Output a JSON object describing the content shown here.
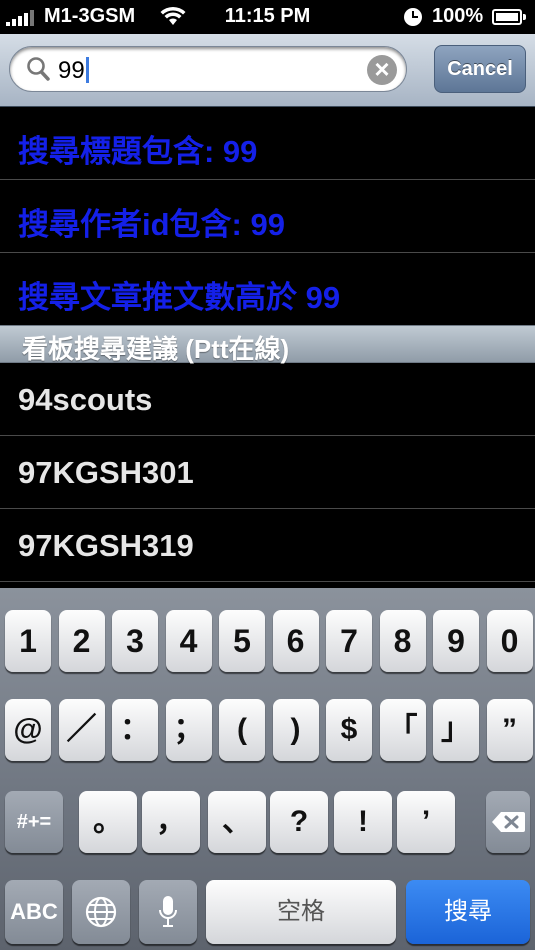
{
  "status_bar": {
    "carrier": "M1-3GSM",
    "time": "11:15 PM",
    "battery": "100%"
  },
  "search": {
    "value": "99",
    "cancel_label": "Cancel"
  },
  "suggestions": [
    {
      "label": "搜尋標題包含: 99"
    },
    {
      "label": "搜尋作者id包含: 99"
    },
    {
      "label": "搜尋文章推文數高於 99"
    }
  ],
  "board_section": {
    "header": "看板搜尋建議 (Ptt在線)",
    "items": [
      {
        "label": "94scouts"
      },
      {
        "label": "97KGSH301"
      },
      {
        "label": "97KGSH319"
      }
    ]
  },
  "keyboard": {
    "row1": [
      "1",
      "2",
      "3",
      "4",
      "5",
      "6",
      "7",
      "8",
      "9",
      "0"
    ],
    "row2": [
      "@",
      "／",
      "：",
      "；",
      "(",
      ")",
      "$",
      "「",
      "」",
      "”"
    ],
    "row3_left": "#+=",
    "row3": [
      "。",
      "，",
      "、",
      "?",
      "!",
      "’"
    ],
    "abc": "ABC",
    "space": "空格",
    "search": "搜尋"
  },
  "colors": {
    "suggestion_text": "#1420e8",
    "board_text": "#e6e6e6",
    "search_key": "#1b64d8"
  }
}
